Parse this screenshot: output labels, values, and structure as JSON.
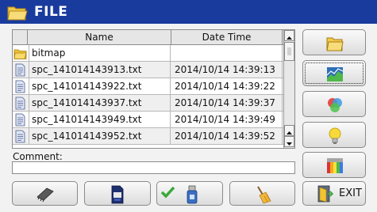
{
  "window": {
    "title": "FILE"
  },
  "table": {
    "columns": [
      "Name",
      "Date Time"
    ],
    "rows": [
      {
        "icon": "folder-icon",
        "name": "bitmap",
        "date": ""
      },
      {
        "icon": "text-file-icon",
        "name": "spc_141014143913.txt",
        "date": "2014/10/14 14:39:13"
      },
      {
        "icon": "text-file-icon",
        "name": "spc_141014143922.txt",
        "date": "2014/10/14 14:39:22"
      },
      {
        "icon": "text-file-icon",
        "name": "spc_141014143937.txt",
        "date": "2014/10/14 14:39:37"
      },
      {
        "icon": "text-file-icon",
        "name": "spc_141014143949.txt",
        "date": "2014/10/14 14:39:49"
      },
      {
        "icon": "text-file-icon",
        "name": "spc_141014143952.txt",
        "date": "2014/10/14 14:39:52"
      }
    ]
  },
  "comment": {
    "label": "Comment:",
    "value": ""
  },
  "side_buttons": [
    "folder-icon",
    "chart-icon",
    "color-circles-icon",
    "lightbulb-icon",
    "spectrum-icon"
  ],
  "bottom_buttons": [
    "memory-chip-icon",
    "sd-card-icon",
    "usb-save-icon",
    "broom-icon",
    "exit-icon"
  ],
  "exit": {
    "label": "EXIT"
  },
  "colors": {
    "title_bar": "#1a3b9e",
    "folder": "#f2c431",
    "row_alt": "#efefef"
  }
}
